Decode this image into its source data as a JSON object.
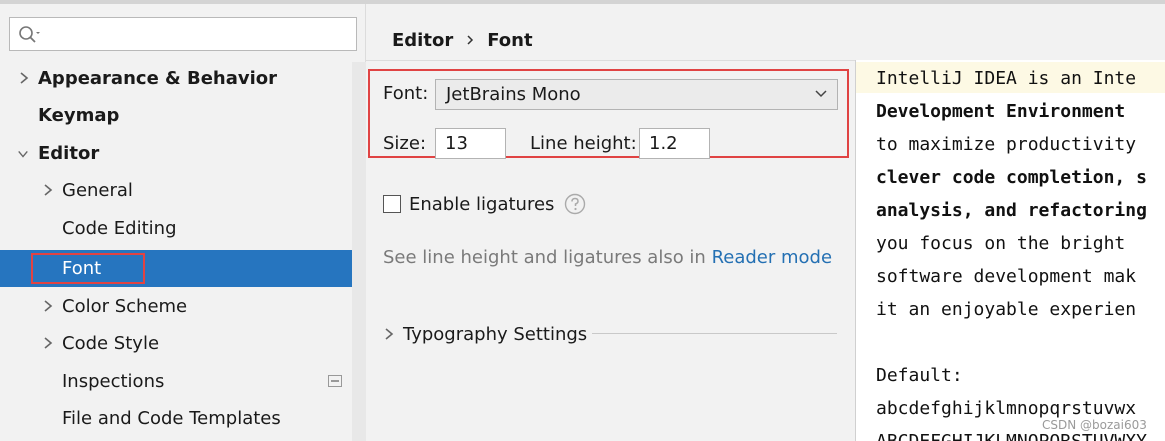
{
  "search": {
    "placeholder": ""
  },
  "sidebar": {
    "items": [
      {
        "label": "Appearance & Behavior"
      },
      {
        "label": "Keymap"
      },
      {
        "label": "Editor"
      },
      {
        "label": "General"
      },
      {
        "label": "Code Editing"
      },
      {
        "label": "Font"
      },
      {
        "label": "Color Scheme"
      },
      {
        "label": "Code Style"
      },
      {
        "label": "Inspections"
      },
      {
        "label": "File and Code Templates"
      }
    ]
  },
  "breadcrumb": {
    "parent": "Editor",
    "current": "Font"
  },
  "font_settings": {
    "font_label": "Font:",
    "font_value": "JetBrains Mono",
    "size_label": "Size:",
    "size_value": "13",
    "line_height_label": "Line height:",
    "line_height_value": "1.2"
  },
  "ligatures": {
    "label": "Enable ligatures"
  },
  "hint": {
    "text": "See line height and ligatures also in",
    "link": "Reader mode"
  },
  "typography": {
    "label": "Typography Settings"
  },
  "preview": {
    "lines": [
      "IntelliJ IDEA is an Inte",
      "Development Environment",
      "to maximize productivity",
      "clever code completion, s",
      "analysis, and refactoring",
      "you focus on the bright",
      "software development mak",
      "it an enjoyable experien",
      "",
      "Default:",
      "abcdefghijklmnopqrstuvwx",
      "ABCDEFGHIJKLMNOPQRSTUVWXY"
    ]
  },
  "watermark": "CSDN @bozai603",
  "colors": {
    "selection": "#2675bf",
    "highlight_box": "#e04343",
    "link": "#2470b3"
  }
}
